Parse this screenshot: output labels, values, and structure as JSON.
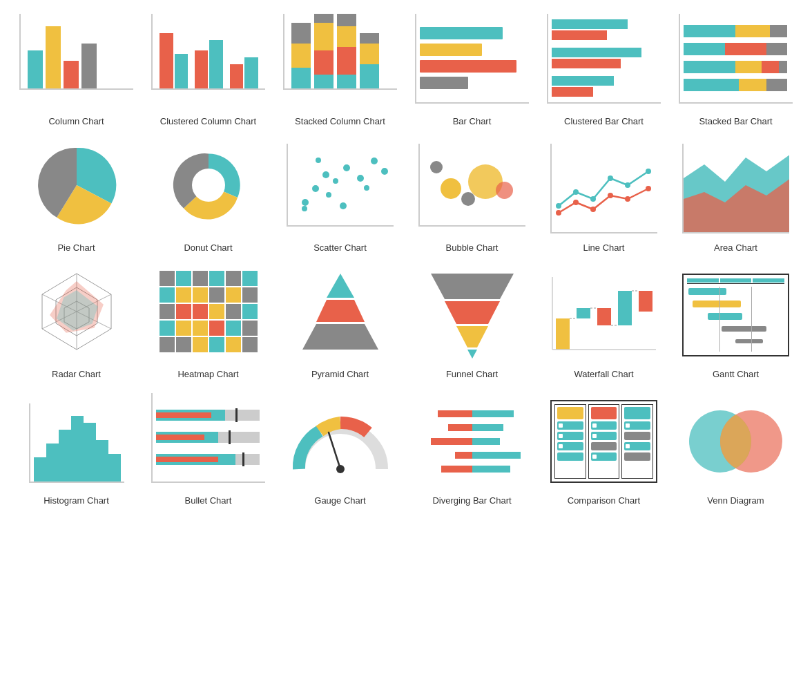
{
  "charts": [
    {
      "id": "column-chart",
      "label": "Column Chart"
    },
    {
      "id": "clustered-column-chart",
      "label": "Clustered Column Chart"
    },
    {
      "id": "stacked-column-chart",
      "label": "Stacked Column Chart"
    },
    {
      "id": "bar-chart",
      "label": "Bar Chart"
    },
    {
      "id": "clustered-bar-chart",
      "label": "Clustered Bar Chart"
    },
    {
      "id": "stacked-bar-chart",
      "label": "Stacked Bar Chart"
    },
    {
      "id": "pie-chart",
      "label": "Pie Chart"
    },
    {
      "id": "donut-chart",
      "label": "Donut Chart"
    },
    {
      "id": "scatter-chart",
      "label": "Scatter Chart"
    },
    {
      "id": "bubble-chart",
      "label": "Bubble Chart"
    },
    {
      "id": "line-chart",
      "label": "Line Chart"
    },
    {
      "id": "area-chart",
      "label": "Area Chart"
    },
    {
      "id": "radar-chart",
      "label": "Radar Chart"
    },
    {
      "id": "heatmap-chart",
      "label": "Heatmap Chart"
    },
    {
      "id": "pyramid-chart",
      "label": "Pyramid Chart"
    },
    {
      "id": "funnel-chart",
      "label": "Funnel Chart"
    },
    {
      "id": "waterfall-chart",
      "label": "Waterfall Chart"
    },
    {
      "id": "gantt-chart",
      "label": "Gantt Chart"
    },
    {
      "id": "histogram-chart",
      "label": "Histogram Chart"
    },
    {
      "id": "bullet-chart",
      "label": "Bullet Chart"
    },
    {
      "id": "gauge-chart",
      "label": "Gauge Chart"
    },
    {
      "id": "diverging-bar-chart",
      "label": "Diverging Bar Chart"
    },
    {
      "id": "comparison-chart",
      "label": "Comparison Chart"
    },
    {
      "id": "venn-diagram",
      "label": "Venn Diagram"
    }
  ],
  "colors": {
    "teal": "#4dbfbf",
    "orange": "#e8614a",
    "yellow": "#f0c040",
    "gray": "#888888",
    "dgray": "#555555"
  }
}
